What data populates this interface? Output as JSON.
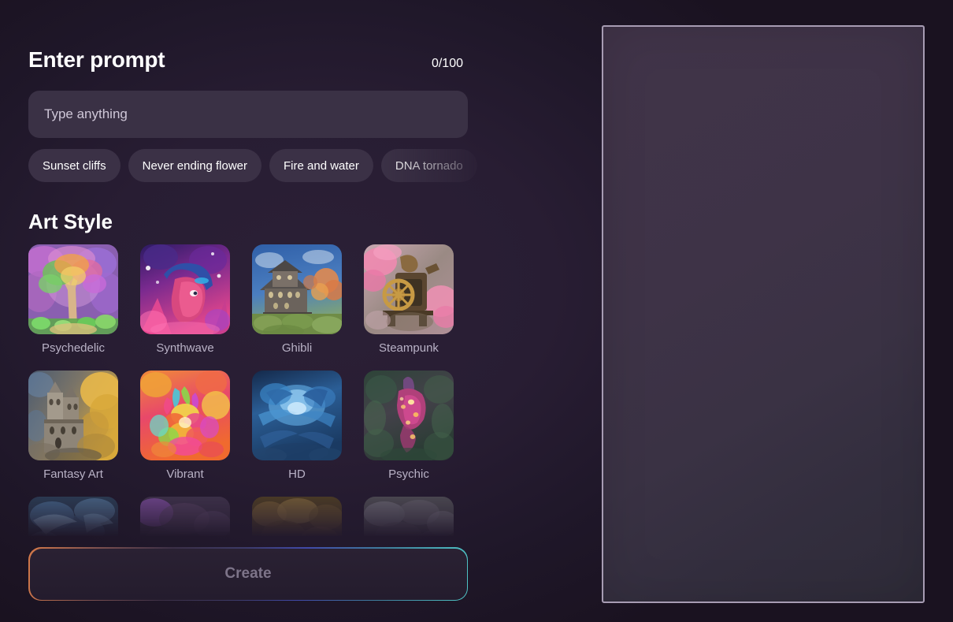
{
  "prompt": {
    "title": "Enter prompt",
    "counter": "0/100",
    "placeholder": "Type anything",
    "value": ""
  },
  "suggestions": [
    {
      "label": "Sunset cliffs"
    },
    {
      "label": "Never ending flower"
    },
    {
      "label": "Fire and water"
    },
    {
      "label": "DNA tornado"
    }
  ],
  "art_style": {
    "title": "Art Style",
    "items": [
      {
        "label": "Psychedelic",
        "thumb": "psychedelic-tree"
      },
      {
        "label": "Synthwave",
        "thumb": "synthwave-portrait"
      },
      {
        "label": "Ghibli",
        "thumb": "ghibli-house"
      },
      {
        "label": "Steampunk",
        "thumb": "steampunk-machine"
      },
      {
        "label": "Fantasy Art",
        "thumb": "fantasy-castle"
      },
      {
        "label": "Vibrant",
        "thumb": "vibrant-flowers"
      },
      {
        "label": "HD",
        "thumb": "hd-blue-ice"
      },
      {
        "label": "Psychic",
        "thumb": "psychic-creature"
      },
      {
        "label": "",
        "thumb": "row3-blue-wave"
      },
      {
        "label": "",
        "thumb": "row3-purple-haze"
      },
      {
        "label": "",
        "thumb": "row3-sepia-scene"
      },
      {
        "label": "",
        "thumb": "row3-grey-scene"
      }
    ]
  },
  "actions": {
    "create_label": "Create"
  },
  "preview": {
    "content": ""
  },
  "colors": {
    "background": "#1f1729",
    "surface": "#3a3145",
    "chip": "#3b3146",
    "text_primary": "#ffffff",
    "text_muted": "#b9b2c6",
    "create_text": "#7d7489",
    "gradient_start": "#d4794a",
    "gradient_mid": "#4049a8",
    "gradient_end": "#4fc6c6",
    "preview_border": "#a79cb3"
  }
}
